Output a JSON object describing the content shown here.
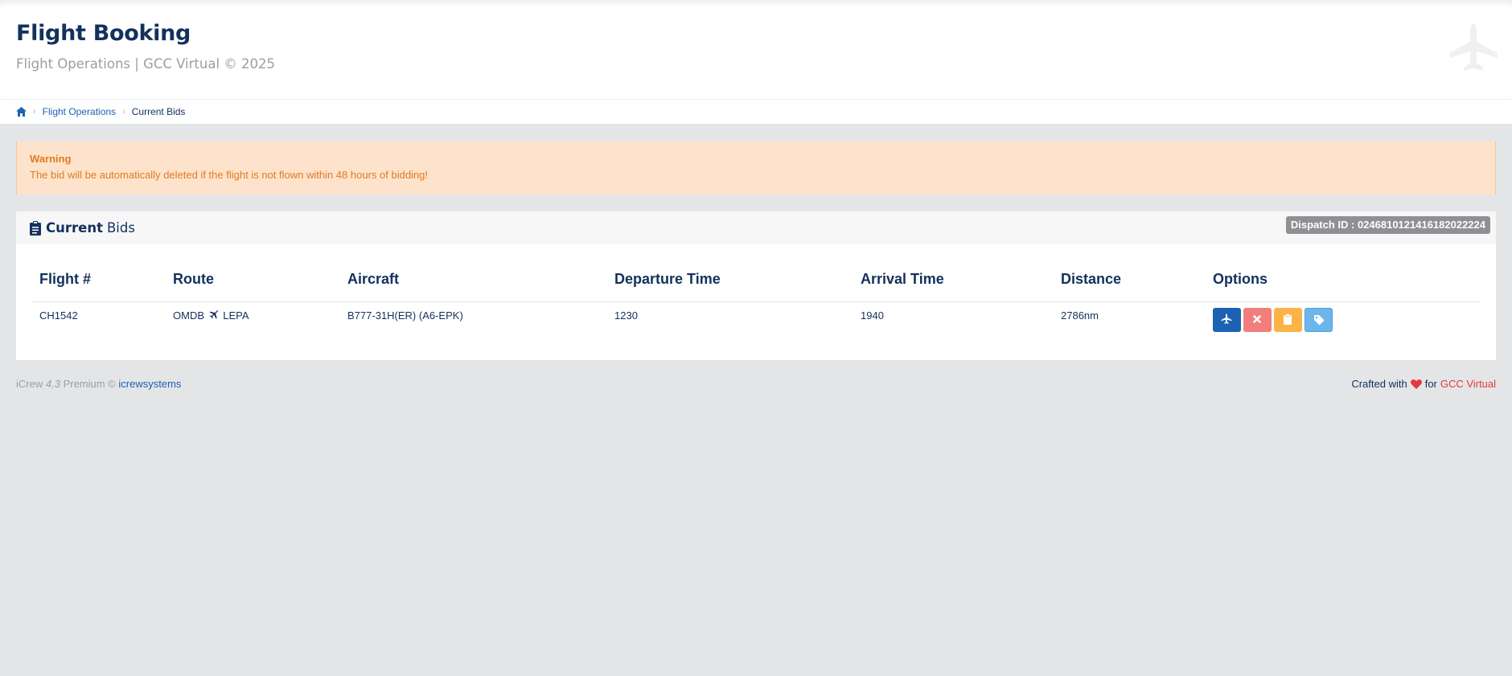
{
  "header": {
    "title": "Flight Booking",
    "subtitle": "Flight Operations | GCC Virtual © 2025",
    "icon": "plane-icon"
  },
  "breadcrumb": {
    "home_icon": "home-icon",
    "items": [
      "Flight Operations",
      "Current Bids"
    ]
  },
  "alert": {
    "title": "Warning",
    "text": "The bid will be automatically deleted if the flight is not flown within 48 hours of bidding!",
    "color": "#e27a22",
    "background": "#fde3cb"
  },
  "panel": {
    "title_strong": "Current",
    "title_light": "Bids",
    "icon": "clipboard-icon",
    "dispatch_badge": "Dispatch ID : 0246810121416182022224"
  },
  "table": {
    "headers": [
      "Flight #",
      "Route",
      "Aircraft",
      "Departure Time",
      "Arrival Time",
      "Distance",
      "Options"
    ],
    "rows": [
      {
        "flight": "CH1542",
        "origin": "OMDB",
        "destination": "LEPA",
        "aircraft": "B777-31H(ER) (A6-EPK)",
        "departure": "1230",
        "arrival": "1940",
        "distance": "2786nm",
        "options": [
          {
            "icon": "plane-icon",
            "color": "#1b62b4"
          },
          {
            "icon": "close-icon",
            "color": "#f07f7c"
          },
          {
            "icon": "clipboard-icon",
            "color": "#fbb347"
          },
          {
            "icon": "tag-icon",
            "color": "#6bb7ec"
          }
        ]
      }
    ]
  },
  "footer": {
    "app_name": "iCrew",
    "version": "4.3",
    "edition": "Premium ©",
    "vendor_link": "icrewsystems",
    "crafted_prefix": "Crafted with",
    "crafted_for": "for",
    "brand": "GCC Virtual",
    "brand_color": "#e23a3a"
  }
}
